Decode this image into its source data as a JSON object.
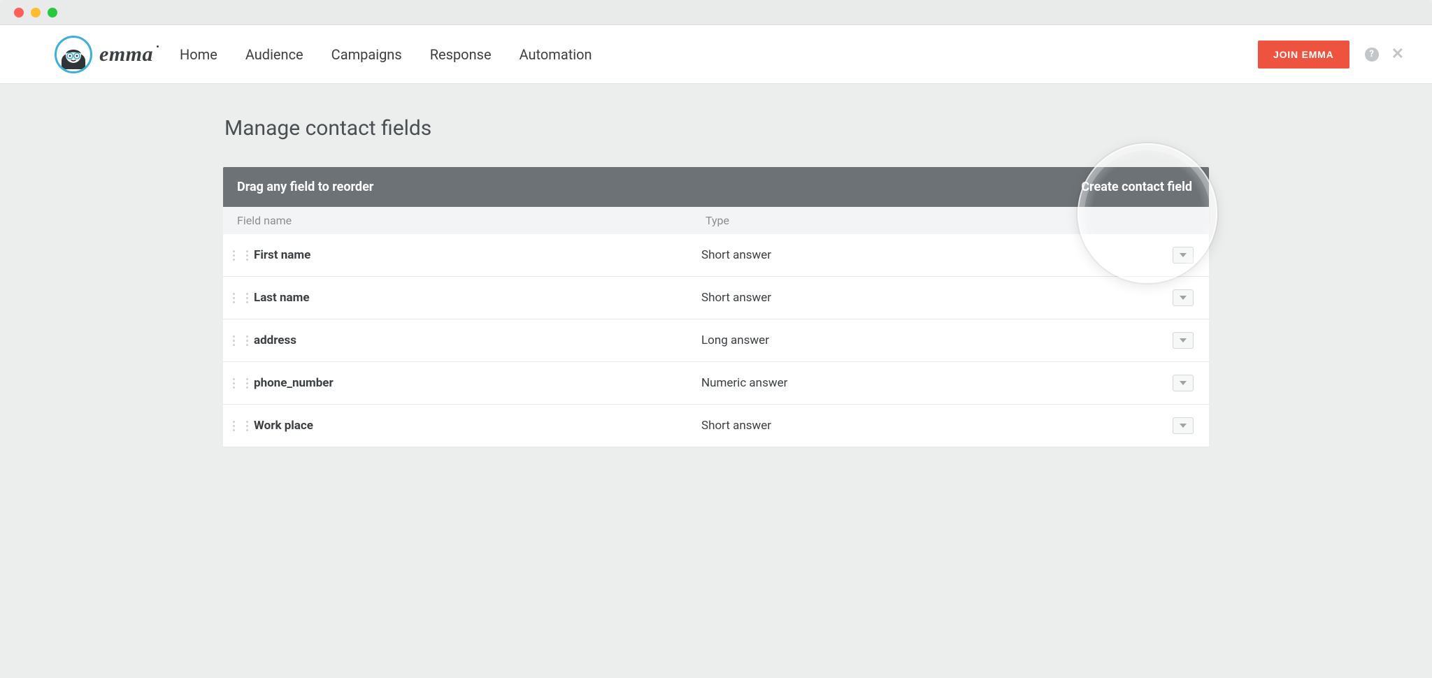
{
  "brand": {
    "name": "emma"
  },
  "nav": {
    "items": [
      {
        "label": "Home"
      },
      {
        "label": "Audience"
      },
      {
        "label": "Campaigns"
      },
      {
        "label": "Response"
      },
      {
        "label": "Automation"
      }
    ],
    "cta": "JOIN EMMA"
  },
  "page": {
    "title": "Manage contact fields",
    "hint": "Drag any field to reorder",
    "create_label": "Create contact field",
    "columns": {
      "name": "Field name",
      "type": "Type"
    },
    "fields": [
      {
        "name": "First name",
        "type": "Short answer"
      },
      {
        "name": "Last name",
        "type": "Short answer"
      },
      {
        "name": "address",
        "type": "Long answer"
      },
      {
        "name": "phone_number",
        "type": "Numeric answer"
      },
      {
        "name": "Work place",
        "type": "Short answer"
      }
    ]
  },
  "colors": {
    "brand_red": "#ee5340",
    "header_dark": "#6c7276",
    "accent": "#3ab0da"
  }
}
